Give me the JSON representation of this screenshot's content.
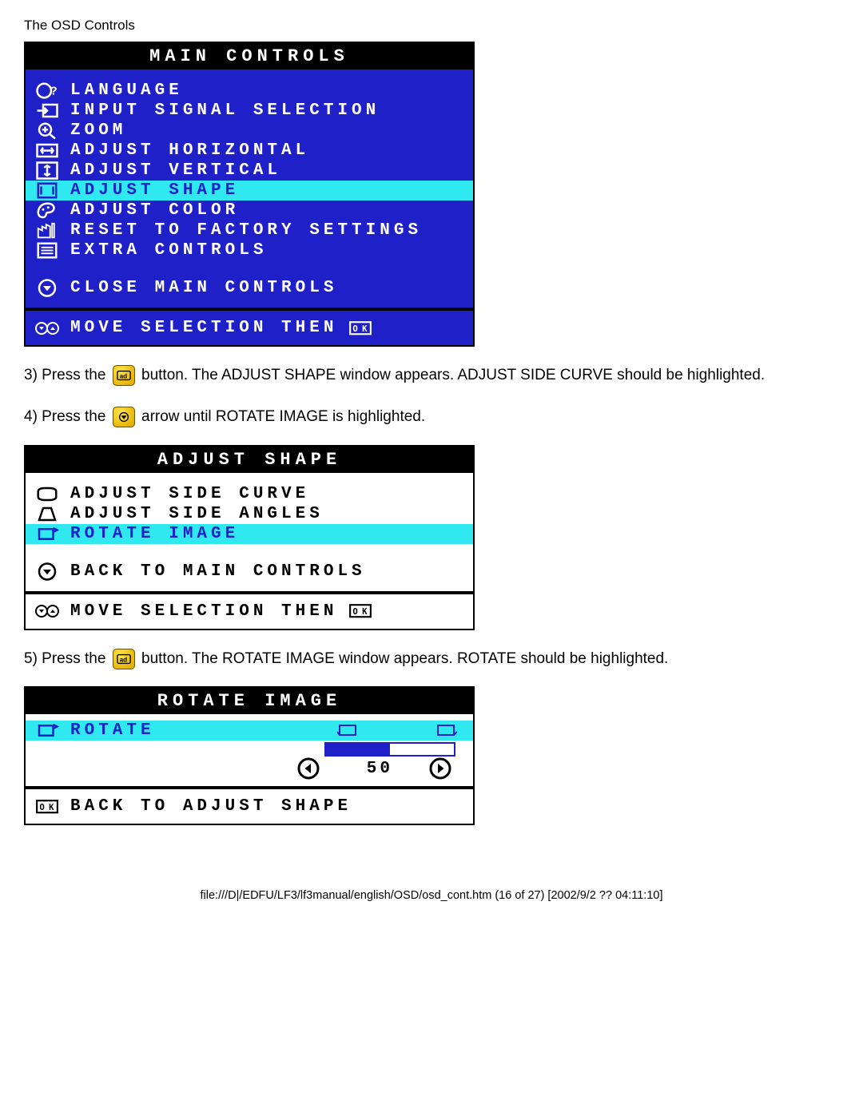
{
  "header": "The OSD Controls",
  "main_controls": {
    "title": "MAIN CONTROLS",
    "items": [
      {
        "icon": "globe-question",
        "label": "LANGUAGE",
        "hl": false
      },
      {
        "icon": "input-arrow",
        "label": "INPUT SIGNAL SELECTION",
        "hl": false
      },
      {
        "icon": "magnify-plus",
        "label": "ZOOM",
        "hl": false
      },
      {
        "icon": "arrows-h",
        "label": "ADJUST HORIZONTAL",
        "hl": false
      },
      {
        "icon": "arrows-v",
        "label": "ADJUST VERTICAL",
        "hl": false
      },
      {
        "icon": "shape",
        "label": "ADJUST SHAPE",
        "hl": true
      },
      {
        "icon": "palette",
        "label": "ADJUST COLOR",
        "hl": false
      },
      {
        "icon": "factory",
        "label": "RESET TO FACTORY SETTINGS",
        "hl": false
      },
      {
        "icon": "extra",
        "label": "EXTRA CONTROLS",
        "hl": false
      }
    ],
    "close": "CLOSE MAIN CONTROLS",
    "footer": "MOVE SELECTION THEN",
    "ok": "OK"
  },
  "step3": {
    "prefix": "3) Press the ",
    "mid": " button. The ADJUST SHAPE window appears. ADJUST SIDE CURVE should be highlighted."
  },
  "step4": {
    "prefix": "4) Press the ",
    "mid": " arrow until ROTATE IMAGE is highlighted."
  },
  "adjust_shape": {
    "title": "ADJUST SHAPE",
    "items": [
      {
        "icon": "side-curve",
        "label": "ADJUST SIDE CURVE",
        "hl": false
      },
      {
        "icon": "side-angles",
        "label": "ADJUST SIDE ANGLES",
        "hl": false
      },
      {
        "icon": "rotate",
        "label": "ROTATE IMAGE",
        "hl": true
      }
    ],
    "back": "BACK TO MAIN CONTROLS",
    "footer": "MOVE SELECTION THEN",
    "ok": "OK"
  },
  "step5": {
    "prefix": "5) Press the ",
    "mid": " button. The ROTATE IMAGE window appears. ROTATE should be highlighted."
  },
  "rotate_image": {
    "title": "ROTATE IMAGE",
    "label": "ROTATE",
    "value": "50",
    "back": "BACK TO ADJUST SHAPE",
    "ok": "OK"
  },
  "footer": "file:///D|/EDFU/LF3/lf3manual/english/OSD/osd_cont.htm (16 of 27) [2002/9/2 ?? 04:11:10]"
}
